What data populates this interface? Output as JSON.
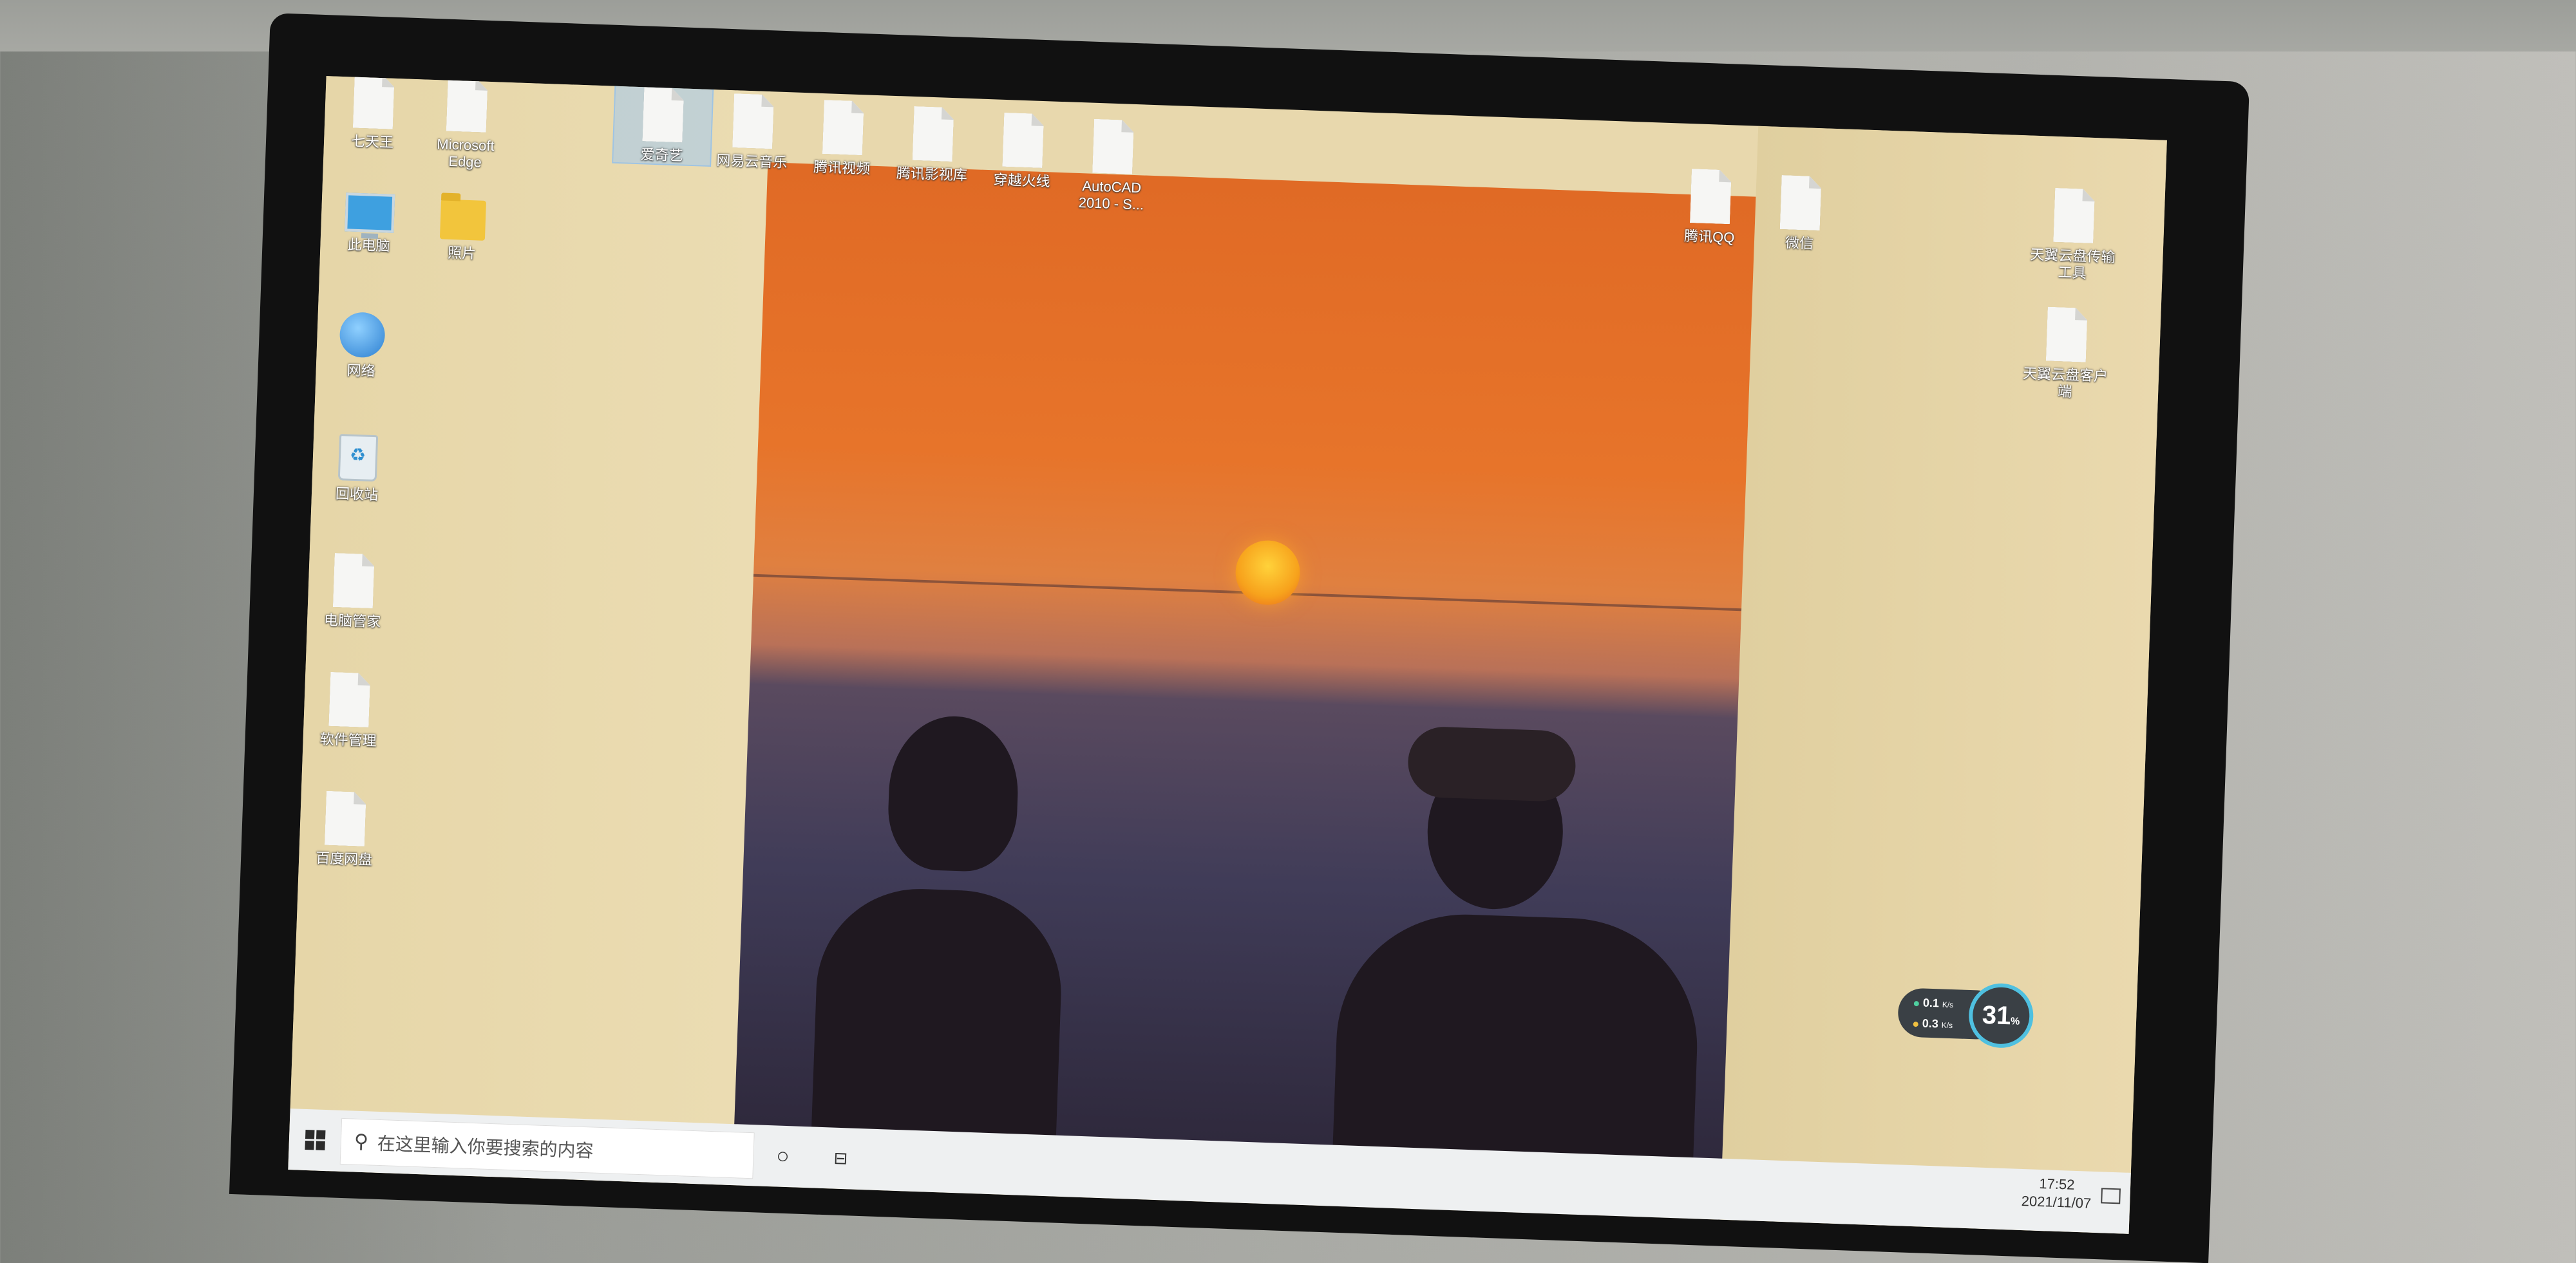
{
  "desktop": {
    "icons": [
      {
        "label": "七天王",
        "glyph": "doc"
      },
      {
        "label": "Microsoft\nEdge",
        "glyph": "doc"
      },
      {
        "label": "此电脑",
        "glyph": "pc"
      },
      {
        "label": "照片",
        "glyph": "folder"
      },
      {
        "label": "网络",
        "glyph": "globe"
      },
      {
        "label": "回收站",
        "glyph": "bin"
      },
      {
        "label": "电脑管家",
        "glyph": "doc"
      },
      {
        "label": "软件管理",
        "glyph": "doc"
      },
      {
        "label": "百度网盘",
        "glyph": "doc"
      },
      {
        "label": "爱奇艺",
        "glyph": "doc"
      },
      {
        "label": "网易云音乐",
        "glyph": "doc"
      },
      {
        "label": "腾讯视频",
        "glyph": "doc"
      },
      {
        "label": "腾讯影视库",
        "glyph": "doc"
      },
      {
        "label": "穿越火线",
        "glyph": "doc"
      },
      {
        "label": "AutoCAD\n2010 - S...",
        "glyph": "doc"
      },
      {
        "label": "腾讯QQ",
        "glyph": "doc"
      },
      {
        "label": "微信",
        "glyph": "doc"
      },
      {
        "label": "天翼云盘传输\n工具",
        "glyph": "doc"
      },
      {
        "label": "天翼云盘客户\n端",
        "glyph": "doc"
      }
    ]
  },
  "taskbar": {
    "search_placeholder": "在这里输入你要搜索的内容",
    "cortana_icon": "circle-icon",
    "taskview_icon": "task-view-icon",
    "time": "17:52",
    "date": "2021/11/07"
  },
  "widget": {
    "upload": "0.1",
    "download": "0.3",
    "unit": "K/s",
    "percent": "31",
    "percent_unit": "%"
  }
}
